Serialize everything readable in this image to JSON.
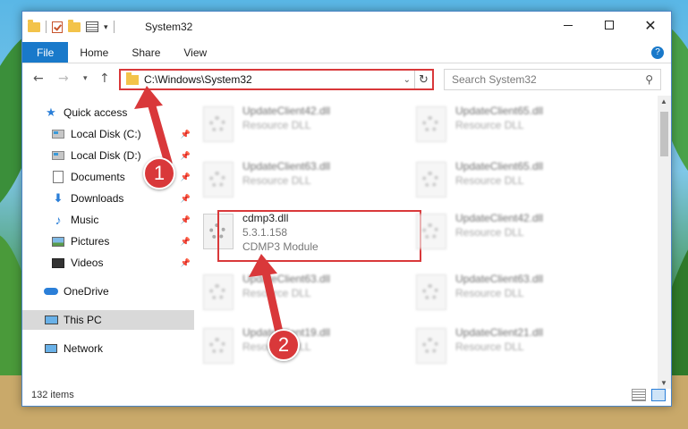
{
  "window": {
    "title": "System32"
  },
  "ribbon": {
    "tabs": [
      "File",
      "Home",
      "Share",
      "View"
    ]
  },
  "address": {
    "path": "C:\\Windows\\System32"
  },
  "search": {
    "placeholder": "Search System32"
  },
  "sidebar": {
    "items": [
      {
        "label": "Quick access",
        "icon": "star-icon",
        "pinned": false
      },
      {
        "label": "Local Disk (C:)",
        "icon": "drive-icon",
        "pinned": true
      },
      {
        "label": "Local Disk (D:)",
        "icon": "drive-icon",
        "pinned": true
      },
      {
        "label": "Documents",
        "icon": "documents-icon",
        "pinned": true
      },
      {
        "label": "Downloads",
        "icon": "download-icon",
        "pinned": true
      },
      {
        "label": "Music",
        "icon": "music-icon",
        "pinned": true
      },
      {
        "label": "Pictures",
        "icon": "pictures-icon",
        "pinned": true
      },
      {
        "label": "Videos",
        "icon": "videos-icon",
        "pinned": true
      },
      {
        "label": "OneDrive",
        "icon": "cloud-icon",
        "pinned": false
      },
      {
        "label": "This PC",
        "icon": "computer-icon",
        "pinned": false,
        "selected": true
      },
      {
        "label": "Network",
        "icon": "network-icon",
        "pinned": false
      }
    ]
  },
  "files": [
    {
      "name": "UpdateClient42.dll",
      "type": "Resource DLL"
    },
    {
      "name": "UpdateClient65.dll",
      "type": "Resource DLL"
    },
    {
      "name": "UpdateClient63.dll",
      "type": "Resource DLL"
    },
    {
      "name": "UpdateClient65.dll",
      "type": "Resource DLL"
    },
    {
      "name": "cdmp3.dll",
      "version": "5.3.1.158",
      "type": "CDMP3 Module",
      "highlighted": true
    },
    {
      "name": "UpdateClient42.dll",
      "type": "Resource DLL"
    },
    {
      "name": "UpdateClient63.dll",
      "type": "Resource DLL"
    },
    {
      "name": "UpdateClient63.dll",
      "type": "Resource DLL"
    },
    {
      "name": "UpdateClient19.dll",
      "type": "Resource DLL"
    },
    {
      "name": "UpdateClient21.dll",
      "type": "Resource DLL"
    }
  ],
  "status": {
    "count": "132 items"
  },
  "callouts": [
    "1",
    "2"
  ],
  "colors": {
    "accent": "#1979ca",
    "callout": "#d9383a"
  }
}
